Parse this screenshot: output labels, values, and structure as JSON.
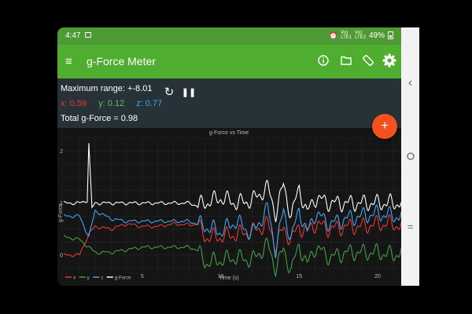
{
  "status_bar": {
    "time": "4:47",
    "signal_text_1": "Vo)\nLTE1",
    "signal_text_2": "Vo)\nLTE2",
    "battery": "49%"
  },
  "app_bar": {
    "menu_glyph": "≡",
    "title": "g-Force Meter",
    "actions": [
      "info-icon",
      "folder-icon",
      "screen-rotation-icon",
      "settings-icon"
    ]
  },
  "readout": {
    "max_range": "Maximum range: +-8.01",
    "x": "x: 0.59",
    "y": "y: 0.12",
    "z": "z: 0.77",
    "total": "Total g-Force = 0.98",
    "refresh_glyph": "↻",
    "pause_glyph": "❚❚"
  },
  "fab": {
    "glyph": "+"
  },
  "colors": {
    "accent": "#4fae2f",
    "x": "#e53935",
    "y": "#43a047",
    "z": "#42a5f5",
    "total": "#ffffff",
    "fab": "#f4511e"
  },
  "chart_data": {
    "type": "line",
    "title": "g-Force vs Time",
    "xlabel": "Time (s)",
    "ylabel": "g-Force",
    "xlim": [
      0,
      21.5
    ],
    "ylim": [
      -0.35,
      2.25
    ],
    "xticks": [
      5,
      10,
      15,
      20
    ],
    "yticks": [
      0,
      1,
      2
    ],
    "grid": true,
    "legend": "bottom-left",
    "series": [
      {
        "name": "x",
        "color": "#e53935",
        "x": [
          0,
          1,
          1.6,
          2,
          3,
          4,
          5,
          6,
          7,
          8,
          8.5,
          9,
          10,
          11,
          12,
          13,
          13.5,
          14,
          14.5,
          15,
          15.5,
          16,
          17,
          18,
          19,
          20,
          21,
          21.5
        ],
        "y": [
          0,
          0,
          0.4,
          0.55,
          0.5,
          0.6,
          0.55,
          0.55,
          0.6,
          0.58,
          0.6,
          0.35,
          0.35,
          0.4,
          0.45,
          0.6,
          0.2,
          0.5,
          0.3,
          0.55,
          0.45,
          0.6,
          0.5,
          0.55,
          0.55,
          0.6,
          0.6,
          0.55
        ]
      },
      {
        "name": "y",
        "color": "#43a047",
        "x": [
          0,
          1,
          1.6,
          2,
          3,
          4,
          5,
          6,
          7,
          8,
          8.5,
          9,
          10,
          11,
          12,
          13,
          13.5,
          14,
          14.5,
          15,
          15.5,
          16,
          17,
          18,
          19,
          20,
          21,
          21.5
        ],
        "y": [
          0.35,
          0.3,
          0.15,
          0.05,
          0.05,
          0.1,
          0.15,
          0.15,
          0.15,
          0.15,
          0.1,
          -0.15,
          -0.1,
          -0.05,
          -0.1,
          0.2,
          -0.25,
          0.1,
          -0.3,
          0.2,
          -0.2,
          0.15,
          -0.05,
          0.05,
          0.05,
          0.05,
          0,
          0.05
        ]
      },
      {
        "name": "z",
        "color": "#42a5f5",
        "x": [
          0,
          1,
          1.6,
          2,
          3,
          4,
          5,
          6,
          7,
          8,
          8.5,
          9,
          10,
          11,
          12,
          13,
          13.5,
          14,
          14.5,
          15,
          15.5,
          16,
          17,
          18,
          19,
          20,
          21,
          21.5
        ],
        "y": [
          0.75,
          0.75,
          0.35,
          0.85,
          0.7,
          0.65,
          0.65,
          0.65,
          0.65,
          0.65,
          0.6,
          0.55,
          0.45,
          0.65,
          0.4,
          0.9,
          0.1,
          0.85,
          0.3,
          0.9,
          0.4,
          0.8,
          0.6,
          0.7,
          0.75,
          0.8,
          0.75,
          0.75
        ]
      },
      {
        "name": "g-Force",
        "color": "#ffffff",
        "x": [
          0,
          1,
          1.5,
          1.6,
          1.8,
          2,
          3,
          4,
          5,
          6,
          7,
          8,
          8.5,
          9,
          10,
          11,
          12,
          13,
          13.5,
          14,
          14.5,
          15,
          15.5,
          16,
          17,
          18,
          19,
          20,
          21,
          21.5
        ],
        "y": [
          1.0,
          1.0,
          1.05,
          2.15,
          0.9,
          1.0,
          1.0,
          1.0,
          1.0,
          1.0,
          1.0,
          1.0,
          0.95,
          1.0,
          1.1,
          1.0,
          1.05,
          1.3,
          0.8,
          1.35,
          0.75,
          1.3,
          0.8,
          1.1,
          1.0,
          1.0,
          1.0,
          1.0,
          1.0,
          1.0
        ]
      }
    ]
  }
}
